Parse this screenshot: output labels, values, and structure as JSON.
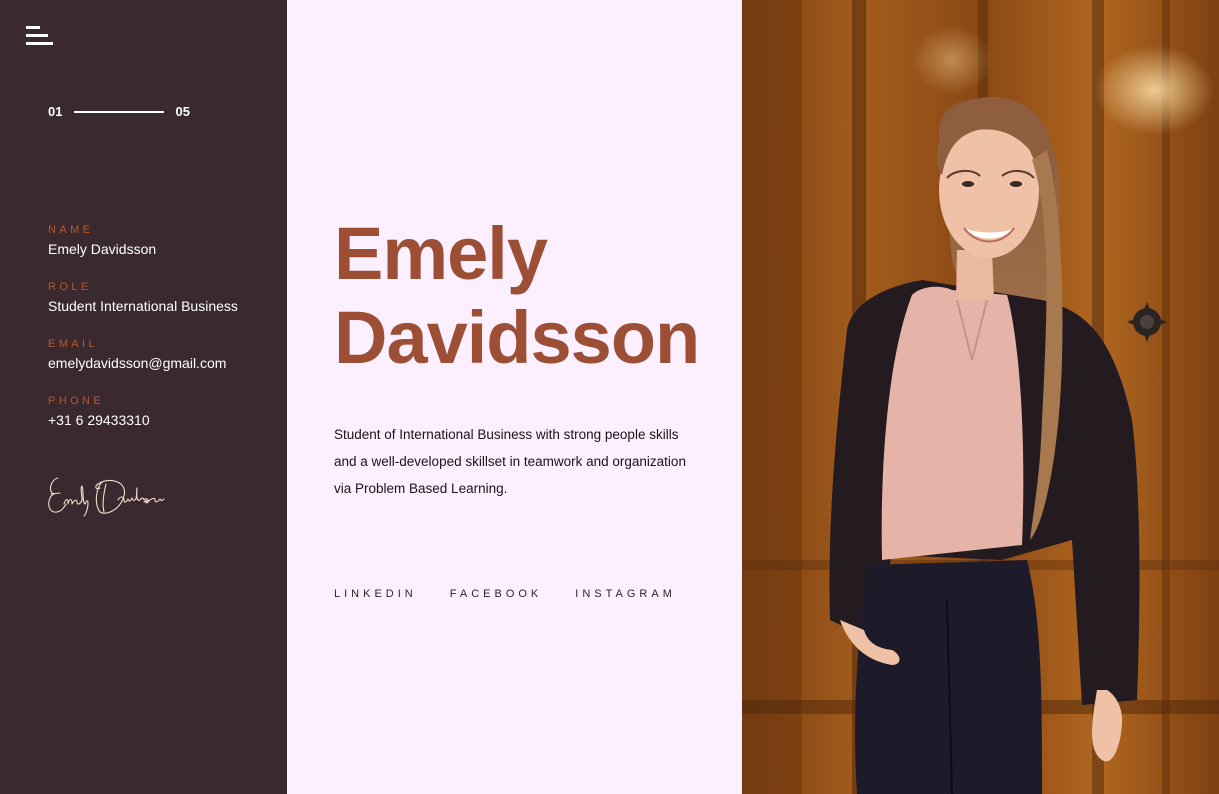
{
  "nav": {
    "menu_icon": "hamburger-icon",
    "pager": {
      "current": "01",
      "total": "05"
    }
  },
  "profile": {
    "fields": [
      {
        "label": "NAME",
        "value": "Emely Davidsson"
      },
      {
        "label": "ROLE",
        "value": "Student International Business"
      },
      {
        "label": "EMAIL",
        "value": "emelydavidsson@gmail.com"
      },
      {
        "label": "PHONE",
        "value": "+31 6 29433310"
      }
    ],
    "signature": "Emely Davidsson"
  },
  "hero": {
    "first_name": "Emely",
    "last_name": "Davidsson",
    "bio": "Student of International Business with strong people skills and a well-developed skillset in teamwork and organization via Problem Based Learning."
  },
  "socials": [
    {
      "label": "LINKEDIN"
    },
    {
      "label": "FACEBOOK"
    },
    {
      "label": "INSTAGRAM"
    }
  ],
  "colors": {
    "sidebar_bg": "#3a2a30",
    "center_bg": "#fcefff",
    "accent": "#9c4f34",
    "label_accent": "#b4582e",
    "door_wood": "#9a5518"
  }
}
